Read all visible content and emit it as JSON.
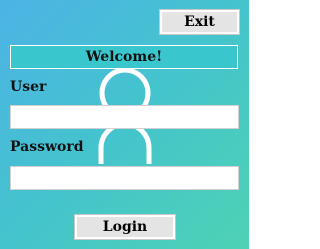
{
  "toolbar": {
    "exit_label": "Exit"
  },
  "header": {
    "welcome_text": "Welcome!"
  },
  "form": {
    "user_label": "User",
    "user_value": "",
    "password_label": "Password",
    "password_value": "",
    "login_label": "Login"
  },
  "icons": {
    "background_figure": "user-silhouette-icon"
  },
  "colors": {
    "background_start": "#4cb3e6",
    "background_end": "#4ed2b4",
    "button_face": "#e4e4e4",
    "field_background": "#ffffff"
  }
}
